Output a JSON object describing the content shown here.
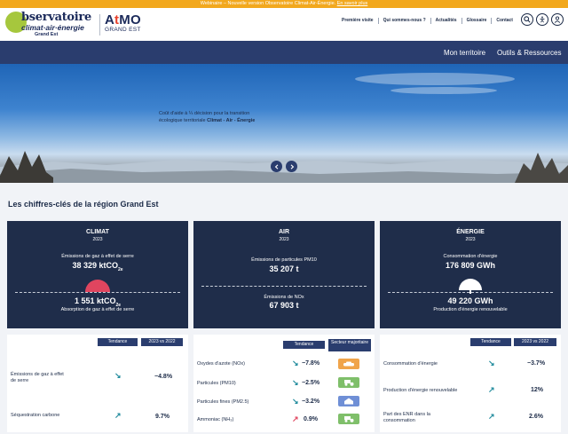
{
  "topbar": {
    "text": "Webinaire – Nouvelle version Observatoire Climat-Air-Énergie.",
    "link": "En savoir plus"
  },
  "header": {
    "logo_obs": {
      "line1": "bservatoire",
      "line2": "climat·air·énergie",
      "line3": "Grand Est"
    },
    "logo_atmo": {
      "a": "A",
      "t": "t",
      "mo": "MO",
      "sub": "GRAND EST"
    },
    "nav": [
      "Première visite",
      "Qui sommes-nous ?",
      "Actualités",
      "Glossaire",
      "Contact"
    ],
    "icons": [
      "search-icon",
      "accessibility-icon",
      "user-icon"
    ]
  },
  "bluenav": {
    "items": [
      "Mon territoire",
      "Outils & Ressources"
    ]
  },
  "hero": {
    "text": "Coût d'aide à ¼ décision pour la transition écologique territoriale",
    "text_bold": "Climat - Air - Énergie"
  },
  "section_title": "Les chiffres-clés de la région Grand Est",
  "cards": [
    {
      "title": "CLIMAT",
      "year": "2023",
      "top_label": "Émissions de gaz à effet de serre",
      "top_value": "38 329 ktCO",
      "top_sub": "2e",
      "bottom_value": "1 551 ktCO",
      "bottom_sub": "2e",
      "bottom_label": "Absorption de gaz à effet de serre",
      "gauge_color": "#e0455f"
    },
    {
      "title": "AIR",
      "year": "2023",
      "top_label": "Émissions de particules PM10",
      "top_value": "35 207 t",
      "bottom_label": "Émissions de NOx",
      "bottom_value": "67 903 t"
    },
    {
      "title": "ÉNERGIE",
      "year": "2023",
      "top_label": "Consommation d'énergie",
      "top_value": "176 809 GWh",
      "bottom_value": "49 220 GWh",
      "bottom_label": "Production d'énergie renouvelable",
      "gauge_color": "#ffffff"
    }
  ],
  "tables": {
    "climat": {
      "headers": [
        "Tendance",
        "2023 vs 2022"
      ],
      "rows": [
        {
          "label": "Émissions de gaz à effet de serre",
          "trend": "down",
          "value": "−4.8%"
        },
        {
          "label": "Séquestration carbone",
          "trend": "up",
          "value": "9.7%"
        }
      ]
    },
    "air": {
      "headers": [
        "Tendance",
        "Secteur majoritaire"
      ],
      "rows": [
        {
          "label": "Oxydes d'azote (NOx)",
          "trend": "down",
          "value": "−7.8%",
          "sector": "transport",
          "sector_color": "#f0a44a"
        },
        {
          "label": "Particules (PM10)",
          "trend": "down",
          "value": "−2.5%",
          "sector": "agriculture",
          "sector_color": "#7fbf6a"
        },
        {
          "label": "Particules fines (PM2.5)",
          "trend": "down",
          "value": "−3.2%",
          "sector": "residential",
          "sector_color": "#6f8fd6"
        },
        {
          "label": "Ammoniac (NH₃)",
          "trend": "up-red",
          "value": "0.9%",
          "sector": "agriculture",
          "sector_color": "#7fbf6a"
        }
      ]
    },
    "energie": {
      "headers": [
        "Tendance",
        "2023 vs 2022"
      ],
      "rows": [
        {
          "label": "Consommation d'énergie",
          "trend": "down",
          "value": "−3.7%"
        },
        {
          "label": "Production d'énergie renouvelable",
          "trend": "up",
          "value": "12%"
        },
        {
          "label": "Part des ENR dans la consommation",
          "trend": "up",
          "value": "2.6%"
        }
      ]
    }
  },
  "colors": {
    "primary": "#1f2d4a",
    "nav": "#2a3d6e",
    "banner": "#f2a81d",
    "trend_ok": "#1f8a9c",
    "trend_bad": "#e0455f"
  },
  "hero_buttons": [
    "chevron-left-icon",
    "chevron-right-icon"
  ]
}
